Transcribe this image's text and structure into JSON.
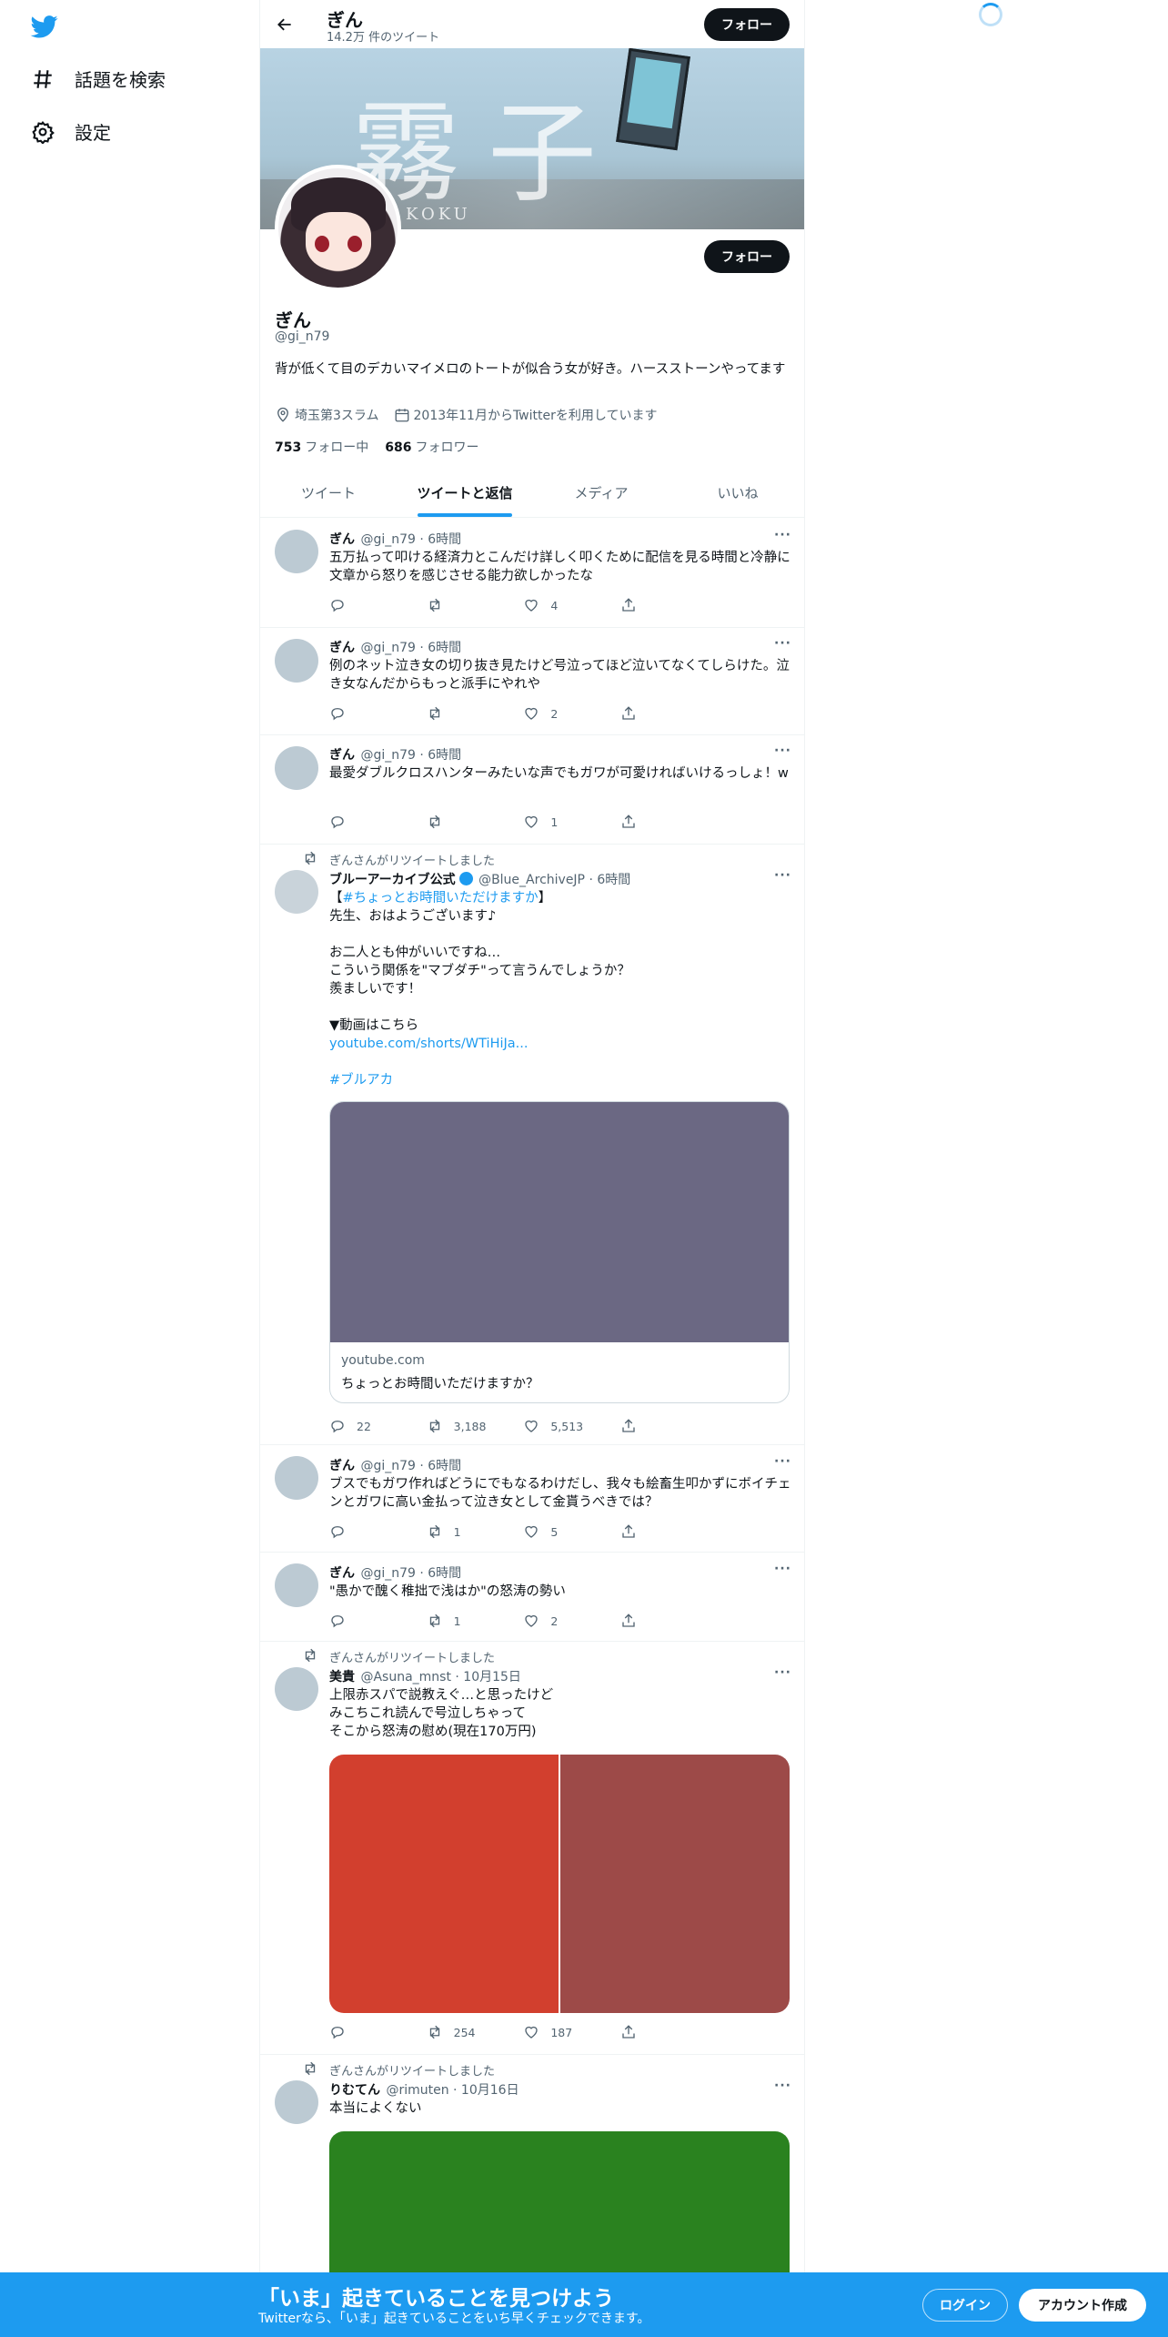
{
  "sidebar": {
    "logo": "twitter-bird-icon",
    "items": [
      {
        "label": "話題を検索",
        "icon": "hashtag-icon"
      },
      {
        "label": "設定",
        "icon": "gear-icon"
      }
    ]
  },
  "header": {
    "name": "ぎん",
    "tweet_count": "14.2万 件のツイート",
    "follow_label": "フォロー"
  },
  "banner": {
    "kanji": "霧子",
    "sub": "KOKU"
  },
  "profile": {
    "name": "ぎん",
    "handle": "@gi_n79",
    "follow_label": "フォロー",
    "bio": "背が低くて目のデカいマイメロのトートが似合う女が好き。ハースストーンやってます",
    "location": "埼玉第3スラム",
    "joined": "2013年11月からTwitterを利用しています",
    "following_count": "753",
    "following_label": "フォロー中",
    "followers_count": "686",
    "followers_label": "フォロワー"
  },
  "tabs": [
    {
      "label": "ツイート",
      "active": false
    },
    {
      "label": "ツイートと返信",
      "active": true
    },
    {
      "label": "メディア",
      "active": false
    },
    {
      "label": "いいね",
      "active": false
    }
  ],
  "tweets": [
    {
      "name": "ぎん",
      "meta": "@gi_n79 · 6時間",
      "text": "五万払って叩ける経済力とこんだけ詳しく叩くために配信を見る時間と冷静に文章から怒りを感じさせる能力欲しかったな",
      "replies": "",
      "retweets": "",
      "likes": "4"
    },
    {
      "name": "ぎん",
      "meta": "@gi_n79 · 6時間",
      "text": "例のネット泣き女の切り抜き見たけど号泣ってほど泣いてなくてしらけた。泣き女なんだからもっと派手にやれや",
      "replies": "",
      "retweets": "",
      "likes": "2"
    },
    {
      "name": "ぎん",
      "meta": "@gi_n79 · 6時間",
      "text": "最愛ダブルクロスハンターみたいな声でもガワが可愛ければいけるっしょ！w",
      "replies": "",
      "retweets": "",
      "likes": "1"
    },
    {
      "retweeted_by": "ぎんさんがリツイートしました",
      "name": "ブルーアーカイブ公式",
      "meta": "@Blue_ArchiveJP · 6時間",
      "hashtag_line_pre": "【",
      "hashtag": "#ちょっとお時間いただけますか",
      "hashtag_line_post": "】",
      "text": "先生、おはようございます♪\n\nお二人とも仲がいいですね…\nこういう関係を\"マブダチ\"って言うんでしょうか？\n羨ましいです！\n\n▼動画はこちら",
      "link": "youtube.com/shorts/WTiHiJa...",
      "tag2": "#ブルアカ",
      "card_domain": "youtube.com",
      "card_title": "ちょっとお時間いただけますか？",
      "replies": "22",
      "retweets": "3,188",
      "likes": "5,513"
    },
    {
      "name": "ぎん",
      "meta": "@gi_n79 · 6時間",
      "text": "ブスでもガワ作ればどうにでもなるわけだし、我々も絵畜生叩かずにボイチェンとガワに高い金払って泣き女として金貰うべきでは？",
      "replies": "",
      "retweets": "1",
      "likes": "5"
    },
    {
      "name": "ぎん",
      "meta": "@gi_n79 · 6時間",
      "text": "\"愚かで醜く稚拙で浅はか\"の怒涛の勢い",
      "replies": "",
      "retweets": "1",
      "likes": "2"
    },
    {
      "retweeted_by": "ぎんさんがリツイートしました",
      "name": "美貴",
      "meta": "@Asuna_mnst · 10月15日",
      "text": "上限赤スパで説教えぐ…と思ったけど\nみこちこれ読んで号泣しちゃって\nそこから怒涛の慰め(現在170万円)",
      "replies": "",
      "retweets": "254",
      "likes": "187",
      "media_colors": [
        "#d23f2e",
        "#9d4a48"
      ]
    },
    {
      "retweeted_by": "ぎんさんがリツイートしました",
      "name": "りむてん",
      "meta": "@rimuten · 10月16日",
      "text": "本当によくない",
      "media_color": "#2a821f"
    }
  ],
  "more_label": "···",
  "bottom_bar": {
    "title": "「いま」起きていることを見つけよう",
    "subtitle": "Twitterなら、「いま」起きていることをいち早くチェックできます。",
    "login": "ログイン",
    "signup": "アカウント作成"
  },
  "colors": {
    "accent": "#1d9bf0",
    "text": "#0f1419",
    "muted": "#536471"
  }
}
